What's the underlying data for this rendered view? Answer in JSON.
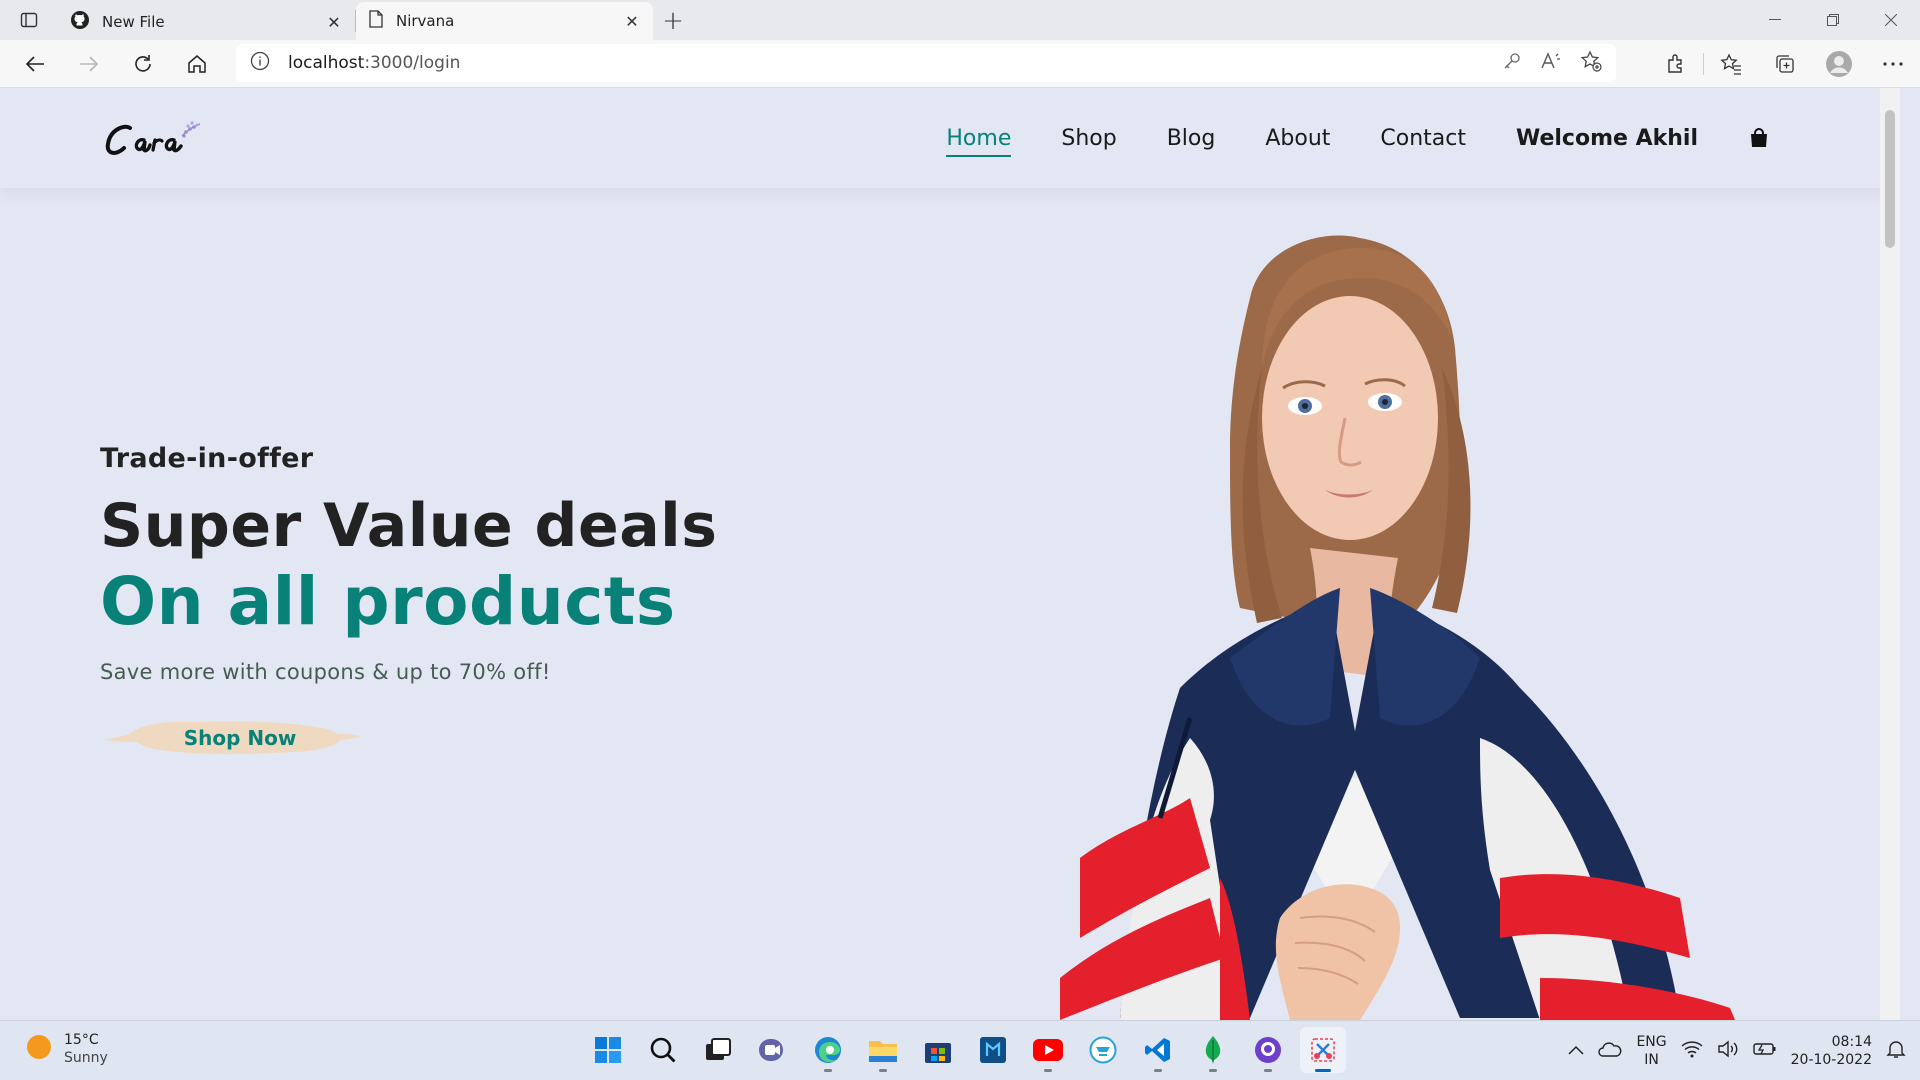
{
  "browser": {
    "tabs": [
      {
        "title": "New File",
        "icon": "github-icon"
      },
      {
        "title": "Nirvana",
        "icon": "page-icon"
      }
    ],
    "address": {
      "host": "localhost",
      "path": ":3000/login"
    }
  },
  "site": {
    "logo_text": "Cara",
    "nav": [
      {
        "label": "Home",
        "active": true
      },
      {
        "label": "Shop"
      },
      {
        "label": "Blog"
      },
      {
        "label": "About"
      },
      {
        "label": "Contact"
      }
    ],
    "welcome": "Welcome Akhil",
    "hero": {
      "kicker": "Trade-in-offer",
      "headline": "Super Value deals",
      "highlight": "On all products",
      "subtext": "Save more with coupons & up to 70% off!",
      "button": "Shop Now"
    },
    "colors": {
      "accent": "#088178",
      "background": "#e3e6f3",
      "button_bg": "#f0d9c1"
    }
  },
  "taskbar": {
    "weather": {
      "temp": "15°C",
      "condition": "Sunny"
    },
    "language": {
      "line1": "ENG",
      "line2": "IN"
    },
    "time": "08:14",
    "date": "20-10-2022"
  }
}
